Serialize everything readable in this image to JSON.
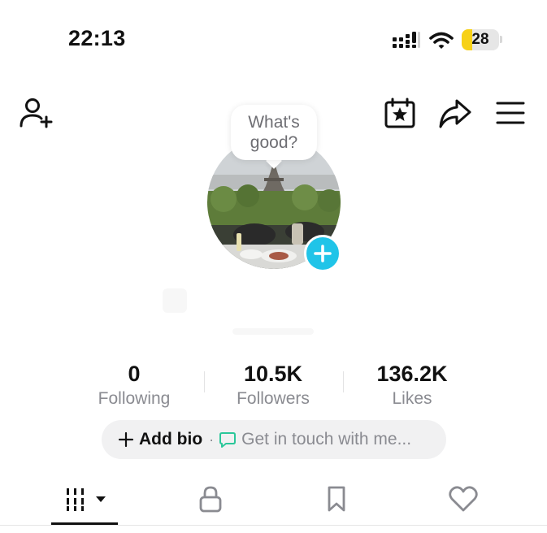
{
  "status_bar": {
    "time": "22:13",
    "battery_level": "28",
    "battery_fraction": 0.28,
    "signal_icon": "cellular-signal-icon",
    "wifi_icon": "wifi-icon"
  },
  "header": {
    "icons": [
      "add-friend-icon",
      "calendar-star-icon",
      "share-icon",
      "menu-icon"
    ]
  },
  "avatar": {
    "bubble_text": "What's good?",
    "plus_icon": "plus-icon",
    "badge_color": "#20c4e8"
  },
  "stats": {
    "following": {
      "value": "0",
      "label": "Following"
    },
    "followers": {
      "value": "10.5K",
      "label": "Followers"
    },
    "likes": {
      "value": "136.2K",
      "label": "Likes"
    }
  },
  "bio": {
    "add_label": "Add bio",
    "separator": "·",
    "contact_label": "Get in touch with me...",
    "chat_icon_color": "#2bc79a"
  },
  "tabs": {
    "items": [
      "videos-grid-icon",
      "lock-icon",
      "bookmark-icon",
      "heart-icon"
    ],
    "active": "videos"
  }
}
